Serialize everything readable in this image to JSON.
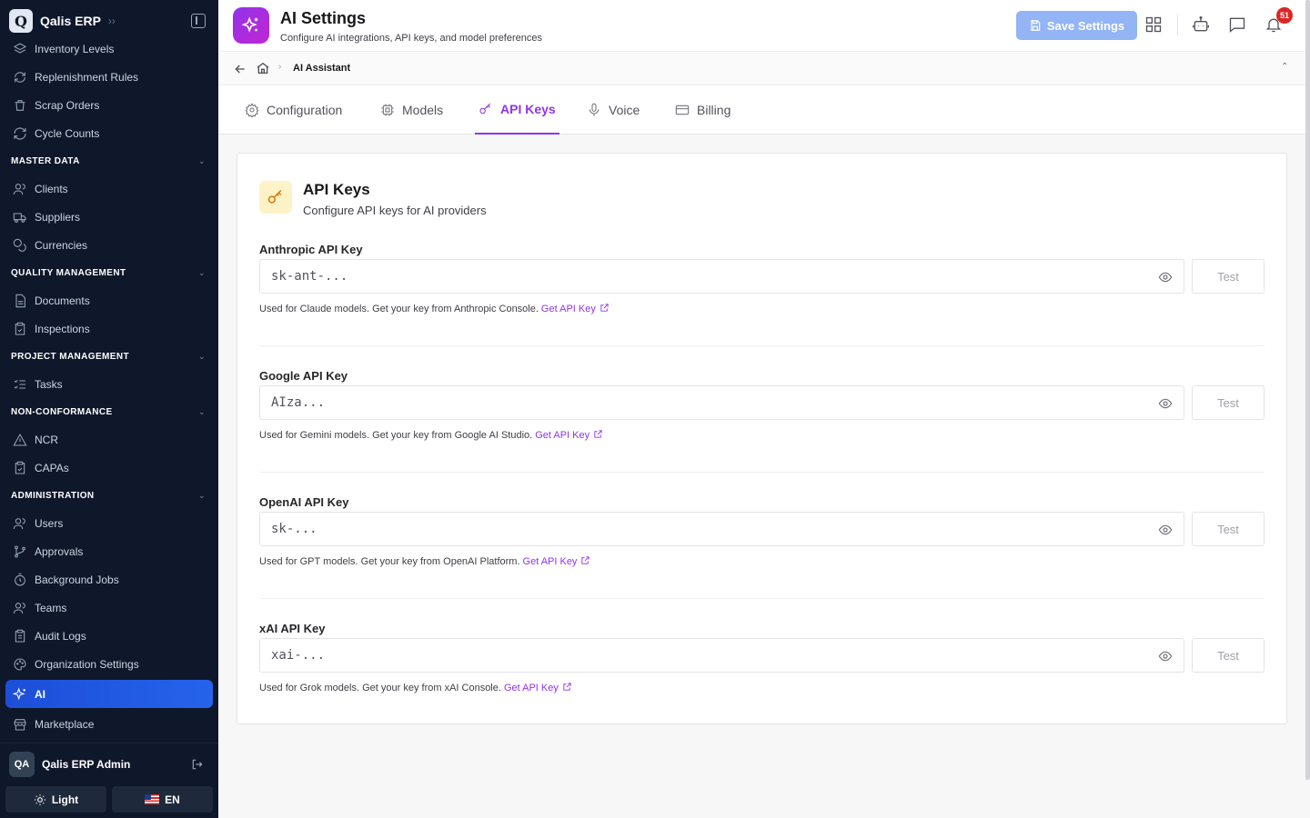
{
  "sidebar": {
    "brand": "Qalis ERP",
    "logo_letter": "Q",
    "top_items": [
      {
        "label": "Inventory Levels",
        "icon": "layers-icon"
      },
      {
        "label": "Replenishment Rules",
        "icon": "refresh-icon"
      },
      {
        "label": "Scrap Orders",
        "icon": "trash-icon"
      },
      {
        "label": "Cycle Counts",
        "icon": "cycle-icon"
      }
    ],
    "sections": [
      {
        "title": "MASTER DATA",
        "items": [
          {
            "label": "Clients",
            "icon": "users-icon"
          },
          {
            "label": "Suppliers",
            "icon": "truck-icon"
          },
          {
            "label": "Currencies",
            "icon": "coins-icon"
          }
        ]
      },
      {
        "title": "QUALITY MANAGEMENT",
        "items": [
          {
            "label": "Documents",
            "icon": "document-icon"
          },
          {
            "label": "Inspections",
            "icon": "clipboard-check-icon"
          }
        ]
      },
      {
        "title": "PROJECT MANAGEMENT",
        "items": [
          {
            "label": "Tasks",
            "icon": "list-checks-icon"
          }
        ]
      },
      {
        "title": "NON-CONFORMANCE",
        "items": [
          {
            "label": "NCR",
            "icon": "warning-icon"
          },
          {
            "label": "CAPAs",
            "icon": "clipboard-check-icon"
          }
        ]
      },
      {
        "title": "ADMINISTRATION",
        "items": [
          {
            "label": "Users",
            "icon": "users-icon"
          },
          {
            "label": "Approvals",
            "icon": "git-branch-icon"
          },
          {
            "label": "Background Jobs",
            "icon": "timer-icon"
          },
          {
            "label": "Teams",
            "icon": "users-icon"
          },
          {
            "label": "Audit Logs",
            "icon": "clipboard-icon"
          },
          {
            "label": "Organization Settings",
            "icon": "palette-icon"
          },
          {
            "label": "AI",
            "icon": "sparkles-icon",
            "active": true
          },
          {
            "label": "Marketplace",
            "icon": "store-icon"
          }
        ]
      }
    ],
    "user": {
      "initials": "QA",
      "name": "Qalis ERP Admin"
    },
    "theme_label": "Light",
    "lang_label": "EN"
  },
  "header": {
    "title": "AI Settings",
    "subtitle": "Configure AI integrations, API keys, and model preferences",
    "save_label": "Save Settings",
    "notification_count": "51"
  },
  "breadcrumb": {
    "current": "AI Assistant"
  },
  "tabs": [
    {
      "label": "Configuration",
      "icon": "gear-icon"
    },
    {
      "label": "Models",
      "icon": "cpu-icon"
    },
    {
      "label": "API Keys",
      "icon": "key-icon",
      "active": true
    },
    {
      "label": "Voice",
      "icon": "microphone-icon"
    },
    {
      "label": "Billing",
      "icon": "credit-card-icon"
    }
  ],
  "card": {
    "title": "API Keys",
    "subtitle": "Configure API keys for AI providers",
    "keys": [
      {
        "label": "Anthropic API Key",
        "placeholder": "sk-ant-...",
        "test_label": "Test",
        "help": "Used for Claude models. Get your key from Anthropic Console.",
        "link": "Get API Key"
      },
      {
        "label": "Google API Key",
        "placeholder": "AIza...",
        "test_label": "Test",
        "help": "Used for Gemini models. Get your key from Google AI Studio.",
        "link": "Get API Key"
      },
      {
        "label": "OpenAI API Key",
        "placeholder": "sk-...",
        "test_label": "Test",
        "help": "Used for GPT models. Get your key from OpenAI Platform.",
        "link": "Get API Key"
      },
      {
        "label": "xAI API Key",
        "placeholder": "xai-...",
        "test_label": "Test",
        "help": "Used for Grok models. Get your key from xAI Console.",
        "link": "Get API Key"
      }
    ]
  },
  "colors": {
    "accent": "#9333ea",
    "sidebar_bg": "#0f172a",
    "active_nav": "#2563eb",
    "save_button": "#93b4f5",
    "badge": "#dc2626"
  }
}
